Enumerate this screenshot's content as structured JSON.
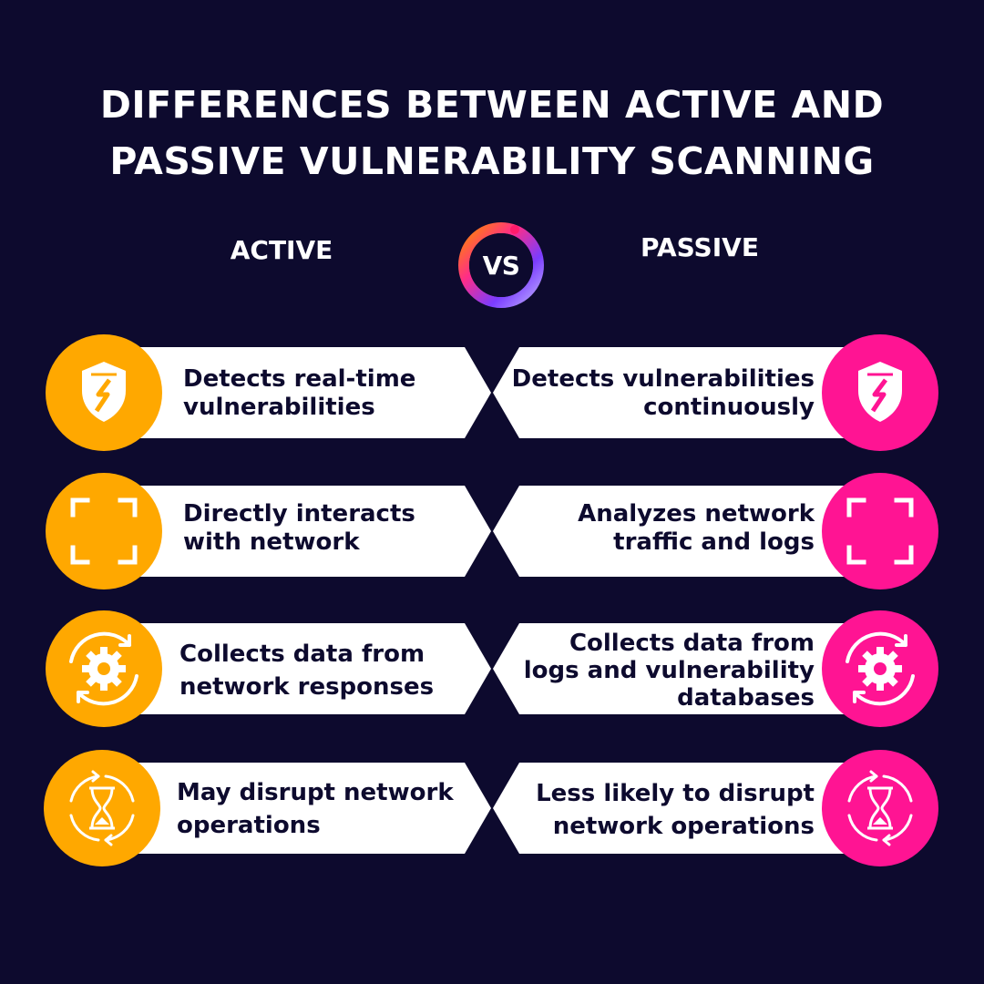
{
  "title": {
    "line1": "DIFFERENCES BETWEEN ACTIVE AND",
    "line2": "PASSIVE VULNERABILITY SCANNING"
  },
  "active_label": "ACTIVE",
  "passive_label": "PASSIVE",
  "vs_label": "VS",
  "colors": {
    "background": "#0d0a2e",
    "active_accent": "#ffa800",
    "passive_accent": "#ff1493",
    "card": "#ffffff"
  },
  "rows": [
    {
      "icon": "shield-icon",
      "active": [
        "Detects real-time",
        "vulnerabilities"
      ],
      "passive": [
        "Detects vulnerabilities",
        "continuously"
      ]
    },
    {
      "icon": "scan-frame-icon",
      "active": [
        "Directly interacts",
        "with network"
      ],
      "passive": [
        "Analyzes network",
        "traffic and logs"
      ]
    },
    {
      "icon": "gear-refresh-icon",
      "active": [
        "Collects data from",
        "network responses"
      ],
      "passive": [
        "Collects data from",
        "logs and vulnerability",
        "databases"
      ]
    },
    {
      "icon": "hourglass-refresh-icon",
      "active": [
        "May disrupt network",
        "operations"
      ],
      "passive": [
        "Less likely to disrupt",
        "network operations"
      ]
    }
  ]
}
